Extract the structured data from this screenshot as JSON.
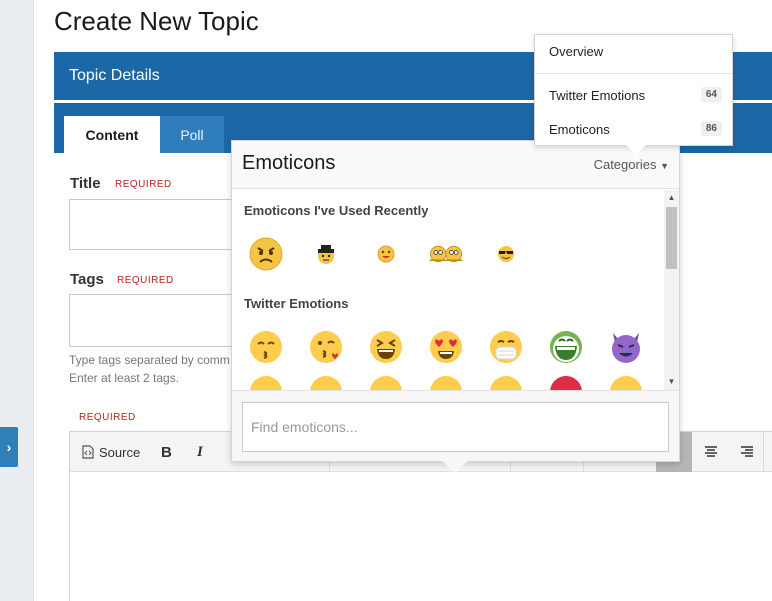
{
  "page": {
    "title": "Create New Topic"
  },
  "topic": {
    "header_title": "Topic Details",
    "tabs": [
      {
        "label": "Content"
      },
      {
        "label": "Poll"
      }
    ]
  },
  "form": {
    "title_label": "Title",
    "tags_label": "Tags",
    "required": "REQUIRED",
    "tags_help_1": "Type tags separated by comm",
    "tags_help_2": "Enter at least 2 tags."
  },
  "toolbar": {
    "source_label": "Source",
    "bold_label": "B",
    "italic_label": "I"
  },
  "emoticons": {
    "title": "Emoticons",
    "categories_label": "Categories",
    "sections": [
      {
        "title": "Emoticons I've Used Recently"
      },
      {
        "title": "Twitter Emotions"
      }
    ],
    "search_placeholder": "Find emoticons..."
  },
  "category_menu": {
    "items": [
      {
        "label": "Overview",
        "count": ""
      },
      {
        "label": "Twitter Emotions",
        "count": "64"
      },
      {
        "label": "Emoticons",
        "count": "86"
      }
    ]
  },
  "colors": {
    "header_blue": "#1c68a6",
    "tab_blue": "#2f7ebb",
    "required_red": "#b3261e"
  }
}
